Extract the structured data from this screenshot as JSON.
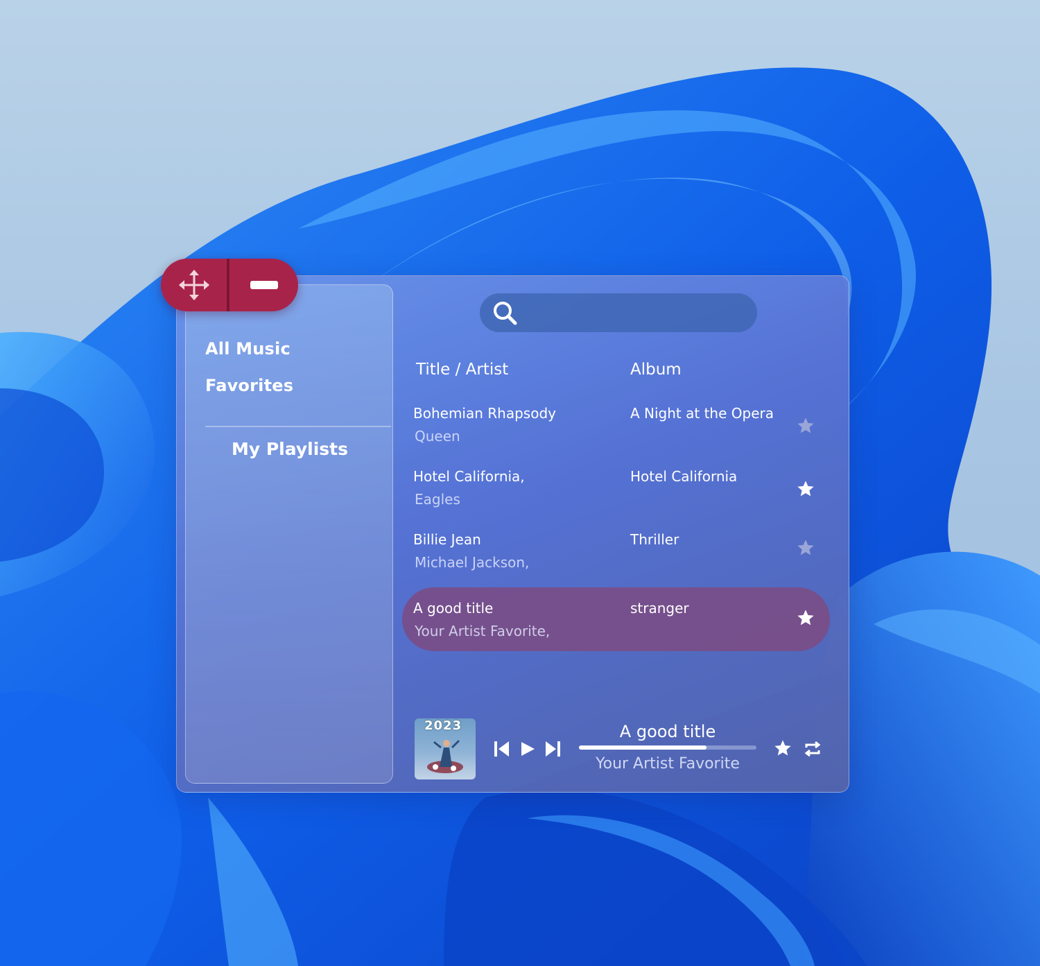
{
  "app": {
    "controls": {
      "move_icon": "move-arrows-icon",
      "minimize_icon": "minimize-icon"
    },
    "sidebar": {
      "items": [
        {
          "label": "All Music"
        },
        {
          "label": "Favorites"
        }
      ],
      "playlists_label": "My Playlists"
    },
    "search": {
      "icon": "search-icon",
      "value": "",
      "placeholder": ""
    },
    "table": {
      "headers": {
        "title_artist": "Title / Artist",
        "album": "Album"
      },
      "rows": [
        {
          "title": "Bohemian Rhapsody",
          "artist": "Queen",
          "album": "A Night at the Opera",
          "favorite": false
        },
        {
          "title": "Hotel California,",
          "artist": "Eagles",
          "album": "Hotel California",
          "favorite": true
        },
        {
          "title": "Billie Jean",
          "artist": "Michael Jackson,",
          "album": "Thriller",
          "favorite": false
        },
        {
          "title": "A good title",
          "artist": "Your Artist Favorite,",
          "album": "stranger",
          "favorite": true,
          "active": true
        }
      ]
    },
    "player": {
      "cover_text": "2023",
      "title": "A good title",
      "artist": "Your Artist Favorite",
      "progress": 0.72,
      "favorite": true,
      "buttons": [
        "previous-icon",
        "play-icon",
        "next-icon",
        "star-icon",
        "repeat-icon"
      ]
    },
    "colors": {
      "accent": "#a8234a",
      "active_row": "#7d4b82",
      "star_on": "#ffffff",
      "star_off": "#9aa6d8"
    }
  }
}
